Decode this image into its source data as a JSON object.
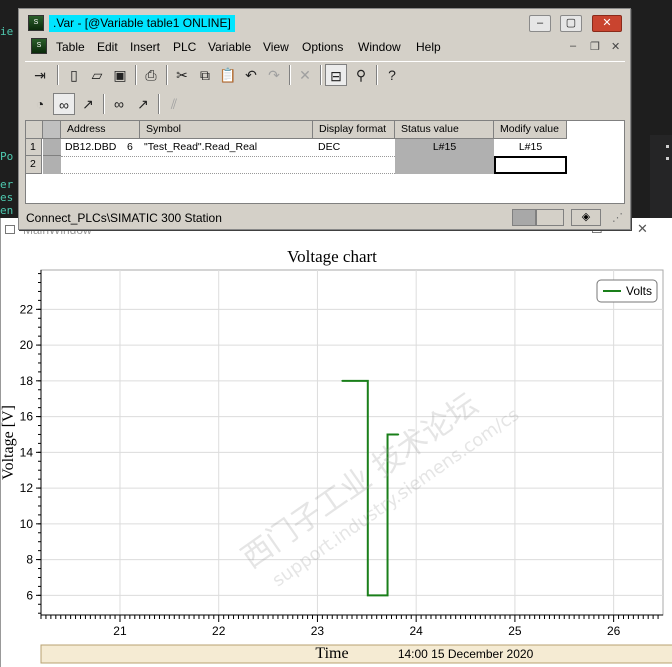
{
  "var_window": {
    "title": ".Var - [@Variable table1  ONLINE]",
    "menu": [
      "Table",
      "Edit",
      "Insert",
      "PLC",
      "Variable",
      "View",
      "Options",
      "Window",
      "Help"
    ],
    "columns": [
      "Address",
      "Symbol",
      "Display format",
      "Status value",
      "Modify value"
    ],
    "rows": [
      {
        "num": "1",
        "address": "DB12.DBD",
        "offset": "6",
        "symbol": "\"Test_Read\".Read_Real",
        "format": "DEC",
        "status": "L#15",
        "modify": "L#15"
      },
      {
        "num": "2",
        "address": "",
        "offset": "",
        "symbol": "",
        "format": "",
        "status": "",
        "modify": ""
      }
    ],
    "status_text": "Connect_PLCs\\SIMATIC 300 Station",
    "toolbar1_icons": [
      "pin-icon",
      "new-icon",
      "open-icon",
      "save-icon",
      "print-icon",
      "cut-icon",
      "copy-icon",
      "paste-icon",
      "undo-icon",
      "redo-icon",
      "delete-icon",
      "monitor-icon",
      "accessible-nodes-icon",
      "help-icon"
    ],
    "toolbar2_icons": [
      "monitor-variable-icon",
      "monitor-glasses-icon",
      "modify-variable-icon",
      "update-monitor-icon",
      "update-modify-icon",
      "force-icon"
    ]
  },
  "chart_window": {
    "title": "MainWindow"
  },
  "background": {
    "code_fragments": [
      "ie",
      "Po",
      "er",
      "es",
      "en"
    ]
  },
  "watermark": {
    "line1": "西门子工业  技术论坛",
    "line2": "support.industry.siemens.com/cs"
  },
  "chart_data": {
    "type": "line",
    "title": "Voltage chart",
    "xlabel": "Time",
    "ylabel": "Voltage [V]",
    "date_label": "14:00 15 December 2020",
    "x_ticks": [
      "21",
      "22",
      "23",
      "24",
      "25",
      "26"
    ],
    "y_ticks": [
      "6",
      "8",
      "10",
      "12",
      "14",
      "16",
      "18",
      "20",
      "22"
    ],
    "xlim": [
      20.2,
      26.5
    ],
    "ylim": [
      4.9,
      24.2
    ],
    "grid": true,
    "legend": "top-right",
    "series": [
      {
        "name": "Volts",
        "color": "#1a7f1a",
        "x": [
          23.25,
          23.51,
          23.51,
          23.71,
          23.71,
          23.72,
          23.72,
          23.82
        ],
        "y": [
          18,
          18,
          6,
          6,
          15,
          15,
          15,
          15
        ]
      }
    ]
  }
}
